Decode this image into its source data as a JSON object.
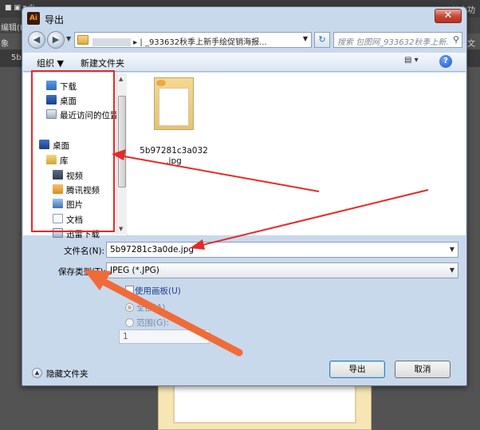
{
  "app": {
    "menu_edit": "编辑(E)",
    "right_top": "基本功",
    "left_side": "象",
    "right_side": "文档",
    "tab": "5b",
    "title_icon": "Ai"
  },
  "dialog": {
    "title": "导出",
    "close": "✕",
    "address_path": "| _933632秋季上新手绘促销海报...",
    "search_placeholder": "搜索 包图网_933632秋季上新...",
    "toolbar": {
      "organize": "组织 ▼",
      "new_folder": "新建文件夹"
    },
    "nav_items": [
      {
        "label": "下载",
        "icon": "download-icon"
      },
      {
        "label": "桌面",
        "icon": "desktop-icon"
      },
      {
        "label": "最近访问的位置",
        "icon": "recent-places-icon"
      },
      {
        "label": "桌面",
        "icon": "desktop-icon"
      },
      {
        "label": "库",
        "icon": "library-icon"
      },
      {
        "label": "视频",
        "icon": "video-icon"
      },
      {
        "label": "腾讯视频",
        "icon": "tencent-video-icon"
      },
      {
        "label": "图片",
        "icon": "pictures-icon"
      },
      {
        "label": "文档",
        "icon": "documents-icon"
      },
      {
        "label": "迅雷下载",
        "icon": "xunlei-download-icon"
      }
    ],
    "file": {
      "name_line1": "5b97281c3a032",
      "name_line2": ".jpg"
    },
    "form": {
      "filename_label": "文件名(N):",
      "filename_value": "5b97281c3a0de.jpg",
      "type_label": "保存类型(T):",
      "type_value": "JPEG (*.JPG)",
      "use_artboards": "使用画板(U)",
      "all": "全部(A)",
      "range": "范围(G):",
      "range_value": "1"
    },
    "hide_folders": "隐藏文件夹",
    "export_button": "导出",
    "cancel_button": "取消"
  }
}
